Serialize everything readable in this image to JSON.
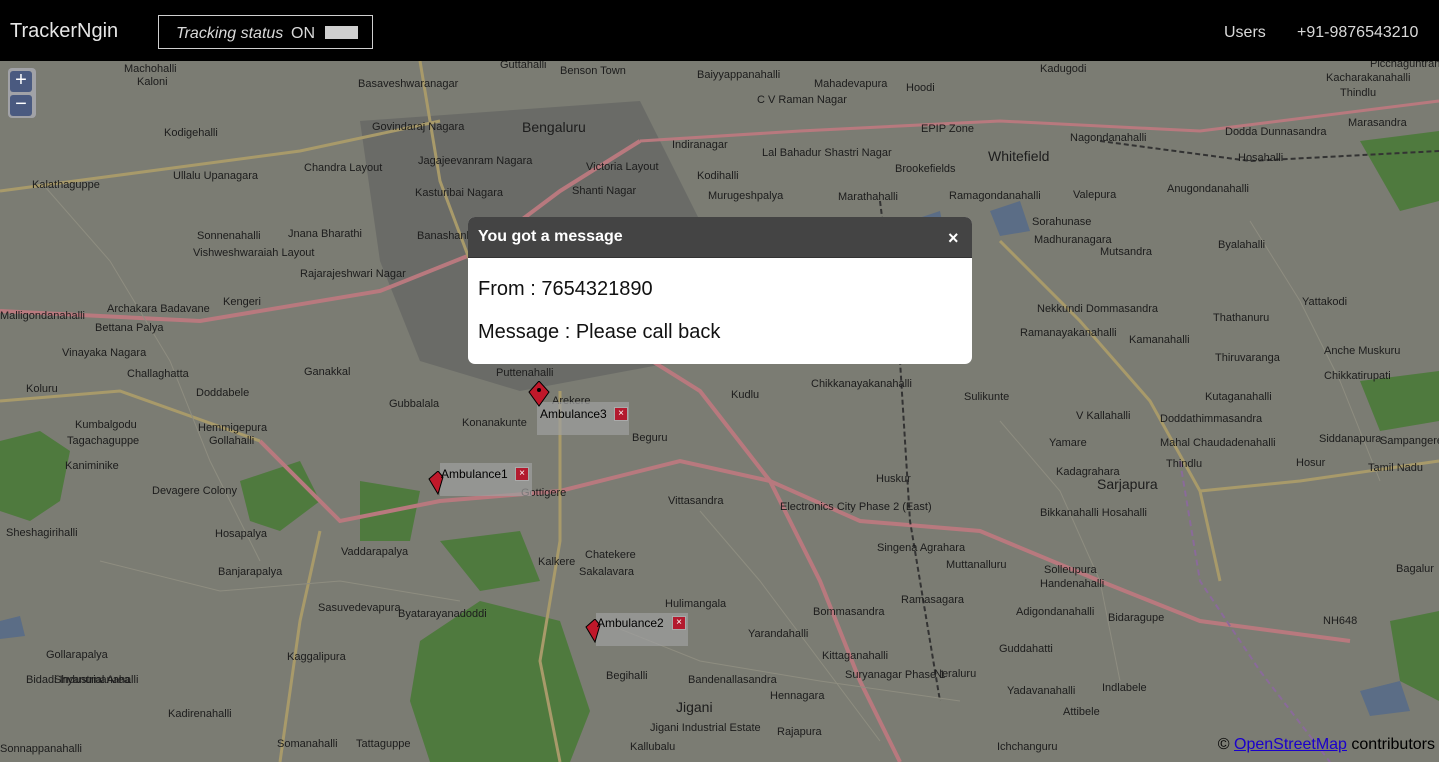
{
  "header": {
    "brand": "TrackerNgin",
    "tracking_label": "Tracking status",
    "tracking_state": "ON",
    "nav_users": "Users",
    "nav_phone": "+91-9876543210"
  },
  "map": {
    "zoom_in": "+",
    "zoom_out": "−",
    "attribution_prefix": "©",
    "attribution_link": "OpenStreetMap",
    "attribution_suffix": "contributors",
    "labels": [
      "Machohalli",
      "Kaloni",
      "Basaveshwaranagar",
      "Guttahalli",
      "Benson Town",
      "Baiyyappanahalli",
      "Mahadevapura",
      "Kadugodi",
      "Kacharakanahalli",
      "Bengaluru",
      "C V Raman Nagar",
      "Hoodi",
      "Whitefield",
      "EPIP Zone",
      "Kodigehalli",
      "Govindaraj Nagara",
      "Chandra Layout",
      "Jagajeevanram Nagara",
      "Indiranagar",
      "Lal Bahadur Shastri Nagar",
      "Brookefields",
      "Nagondanahalli",
      "Dodda Dunnasandra",
      "Marasandra",
      "Ullalu Upanagara",
      "Victoria Layout",
      "Kodihalli",
      "Kasturibai Nagara",
      "Shanti Nagar",
      "Murugeshpalya",
      "Marathahalli",
      "Ramagondanahalli",
      "Valepura",
      "Anugondanahalli",
      "Hosahalli",
      "Kalathaguppe",
      "Sonnenahalli",
      "Vishweshwaraiah Layout",
      "Jnana Bharathi",
      "Rajarajeshwari Nagar",
      "Banashankari 1st Stage",
      "Sorahunase",
      "Madhuranagara",
      "Mutsandra",
      "Byalahalli",
      "Kengeri",
      "Nekkundi Dommasandra",
      "Yattakodi",
      "Archakara Badavane",
      "Bettana Palya",
      "Malligondanahalli",
      "Ramanayakanahalli",
      "Thathanuru",
      "Kamanahalli",
      "Vinayaka Nagara",
      "Challaghatta",
      "Ganakkal",
      "Puttenahalli",
      "Chikkanayakanahalli",
      "Thiruvaranga",
      "Anche Muskuru",
      "Koluru",
      "Doddabele",
      "Gubbalala",
      "Arekere",
      "Kudlu",
      "Sulikunte",
      "Kutaganahalli",
      "Chikkatirupati",
      "Kumbalgodu",
      "Hemmigepura",
      "Gollahalli",
      "Konanakunte",
      "Beguru",
      "V Kallahalli",
      "Doddathimmasandra",
      "Kalkere",
      "Tagachaguppe",
      "Kaniminike",
      "Yamare",
      "Mahal Chaudadenahalli",
      "Siddanapura",
      "Sampangere",
      "Devagere Colony",
      "Gottigere",
      "Vittasandra",
      "Huskur",
      "Kadagrahara",
      "Sarjapura",
      "Thindlu",
      "Electronics City Phase 2 (East)",
      "Sheshagirihalli",
      "Vaddarapalya",
      "Singena Agrahara",
      "Bikkanahalli Hosahalli",
      "Hosapalya",
      "Chatekere",
      "Muttanalluru",
      "Solleupura",
      "Banjarapalya",
      "Sakalavara",
      "Hulimangala",
      "Bommasandra",
      "Ramasagara",
      "Handenahalli",
      "Sasuvedevapura",
      "Byatarayanadoddi",
      "Adigondanahalli",
      "Bidaragupe",
      "Gollarapalya",
      "Kaggalipura",
      "Yarandahalli",
      "Kittaganahalli",
      "Guddahatti",
      "Shyanumanahalli",
      "Begihalli",
      "Bandenallasandra",
      "Suryanagar Phase 1",
      "Neraluru",
      "Yadavanahalli",
      "Indlabele",
      "Kadirenahalli",
      "Jigani",
      "Hennagara",
      "Attibele",
      "Somanahalli",
      "Tattaguppe",
      "Kallubalu",
      "Rajapura",
      "Ichchanguru",
      "Bagalur",
      "NH648",
      "Picchaguntrahalli",
      "Thindlu",
      "Tamil Nadu",
      "Hosur",
      "Bidadi Industrial Area",
      "Jigani Industrial Estate",
      "Sonnappanahalli"
    ],
    "markers": [
      {
        "label": "Ambulance3"
      },
      {
        "label": "Ambulance1"
      },
      {
        "label": "Ambulance2"
      }
    ]
  },
  "dialog": {
    "title": "You got a message",
    "close_label": "×",
    "from_line": "From : 7654321890",
    "message_line": "Message : Please call back"
  }
}
